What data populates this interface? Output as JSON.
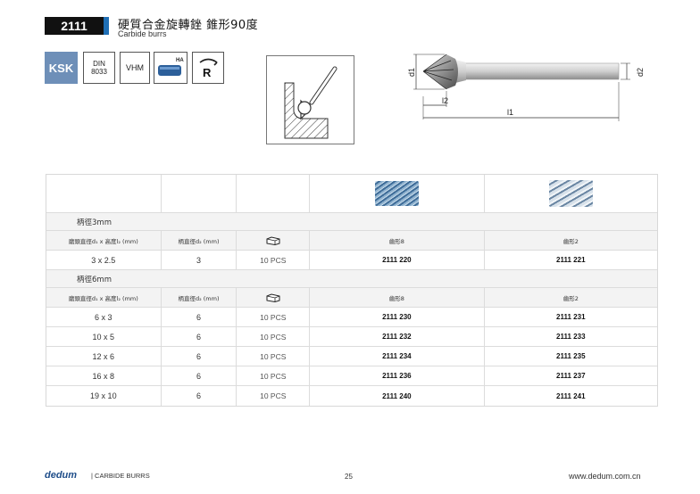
{
  "header": {
    "code": "2111",
    "title_cn": "硬質合金旋轉銼 錐形90度",
    "title_en": "Carbide burrs"
  },
  "specs": {
    "ksk": "KSK",
    "din_line1": "DIN",
    "din_line2": "8033",
    "vhm": "VHM",
    "ha": "HA",
    "r": "R"
  },
  "drawing": {
    "d1": "d1",
    "d2": "d2",
    "l1": "l1",
    "l2": "l2"
  },
  "table": {
    "groups": [
      {
        "label": "柄徑3mm",
        "headers": [
          "磨頭直徑d₁ x 高度l₂ (mm)",
          "柄直徑d₂ (mm)",
          "",
          "齒形8",
          "齒形2"
        ],
        "rows": [
          {
            "size": "3 x 2.5",
            "shank": "3",
            "pcs": "10 PCS",
            "cut8": "2111 220",
            "cut2": "2111 221"
          }
        ]
      },
      {
        "label": "柄徑6mm",
        "headers": [
          "磨頭直徑d₁ x 高度l₂ (mm)",
          "柄直徑d₂ (mm)",
          "",
          "齒形8",
          "齒形2"
        ],
        "rows": [
          {
            "size": "6 x 3",
            "shank": "6",
            "pcs": "10 PCS",
            "cut8": "2111 230",
            "cut2": "2111 231"
          },
          {
            "size": "10 x 5",
            "shank": "6",
            "pcs": "10 PCS",
            "cut8": "2111 232",
            "cut2": "2111 233"
          },
          {
            "size": "12 x 6",
            "shank": "6",
            "pcs": "10 PCS",
            "cut8": "2111 234",
            "cut2": "2111 235"
          },
          {
            "size": "16 x 8",
            "shank": "6",
            "pcs": "10 PCS",
            "cut8": "2111 236",
            "cut2": "2111 237"
          },
          {
            "size": "19 x 10",
            "shank": "6",
            "pcs": "10 PCS",
            "cut8": "2111 240",
            "cut2": "2111 241"
          }
        ]
      }
    ]
  },
  "footer": {
    "brand": "dedum",
    "sub": "| CARBIDE BURRS",
    "page": "25",
    "url": "www.dedum.com.cn"
  },
  "colors": {
    "accent": "#1f6fb5",
    "ksk": "#6e8fb8"
  },
  "icons": [
    "package-icon",
    "rotation-icon",
    "shank-icon"
  ]
}
